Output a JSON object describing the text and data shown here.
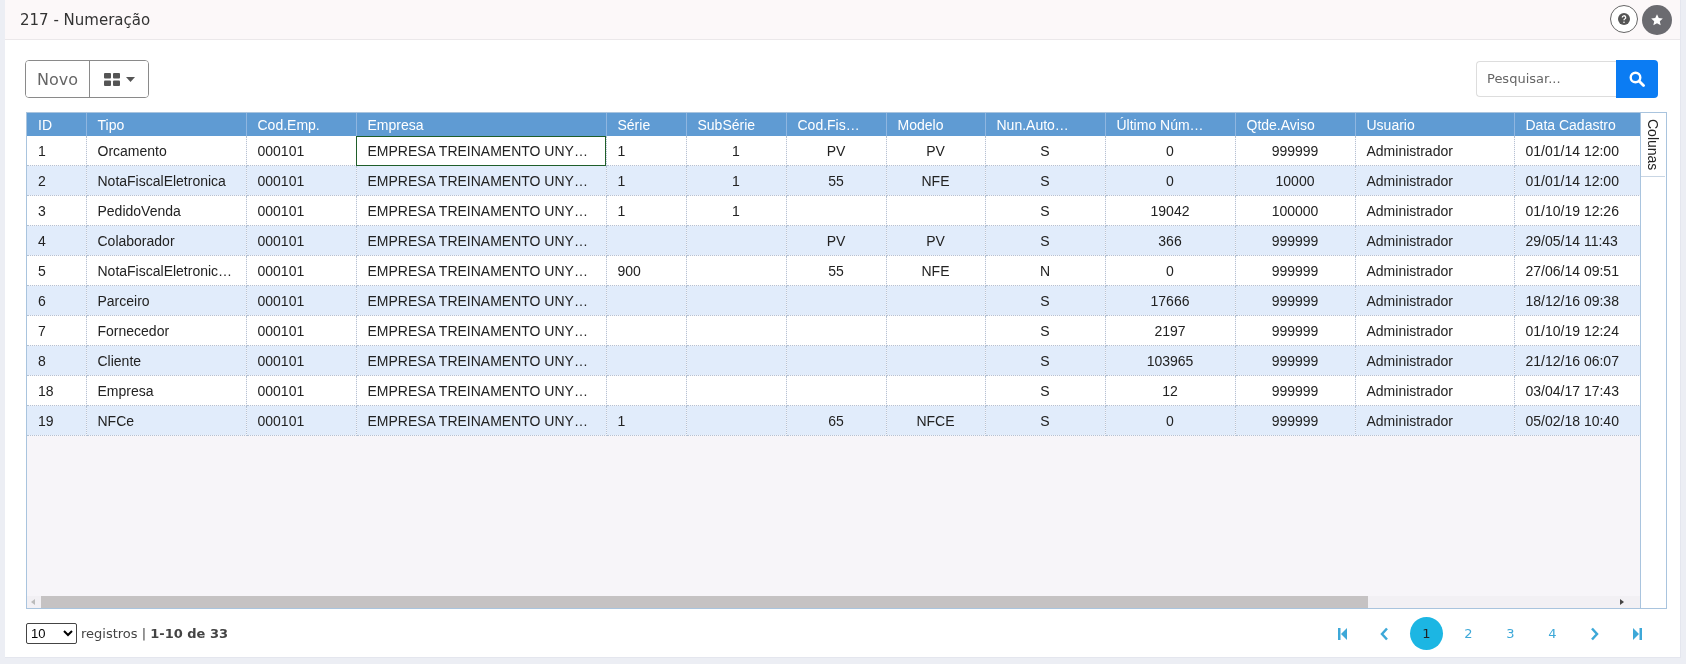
{
  "page": {
    "title": "217 - Numeração"
  },
  "toolbar": {
    "new_button": "Novo",
    "search": {
      "placeholder": "Pesquisar..."
    }
  },
  "table": {
    "columns": [
      "ID",
      "Tipo",
      "Cod.Emp.",
      "Empresa",
      "Série",
      "SubSérie",
      "Cod.Fis…",
      "Modelo",
      "Nun.Auto…",
      "Último Núm…",
      "Qtde.Aviso",
      "Usuario",
      "Data Cadastro"
    ],
    "rows": [
      [
        "1",
        "Orcamento",
        "000101",
        {
          "text": "EMPRESA TREINAMENTO UNY…",
          "focused": true
        },
        "1",
        "1",
        "PV",
        "PV",
        "S",
        "0",
        "999999",
        "Administrador",
        "01/01/14 12:00"
      ],
      [
        "2",
        "NotaFiscalEletronica",
        "000101",
        "EMPRESA TREINAMENTO UNY…",
        "1",
        "1",
        "55",
        "NFE",
        "S",
        "0",
        "10000",
        "Administrador",
        "01/01/14 12:00"
      ],
      [
        "3",
        "PedidoVenda",
        "000101",
        "EMPRESA TREINAMENTO UNY…",
        "1",
        "1",
        "",
        "",
        "S",
        "19042",
        "100000",
        "Administrador",
        "01/10/19 12:26"
      ],
      [
        "4",
        "Colaborador",
        "000101",
        "EMPRESA TREINAMENTO UNY…",
        "",
        "",
        "PV",
        "PV",
        "S",
        "366",
        "999999",
        "Administrador",
        "29/05/14 11:43"
      ],
      [
        "5",
        "NotaFiscalEletronic…",
        "000101",
        "EMPRESA TREINAMENTO UNY…",
        "900",
        "",
        "55",
        "NFE",
        "N",
        "0",
        "999999",
        "Administrador",
        "27/06/14 09:51"
      ],
      [
        "6",
        "Parceiro",
        "000101",
        "EMPRESA TREINAMENTO UNY…",
        "",
        "",
        "",
        "",
        "S",
        "17666",
        "999999",
        "Administrador",
        "18/12/16 09:38"
      ],
      [
        "7",
        "Fornecedor",
        "000101",
        "EMPRESA TREINAMENTO UNY…",
        "",
        "",
        "",
        "",
        "S",
        "2197",
        "999999",
        "Administrador",
        "01/10/19 12:24"
      ],
      [
        "8",
        "Cliente",
        "000101",
        "EMPRESA TREINAMENTO UNY…",
        "",
        "",
        "",
        "",
        "S",
        "103965",
        "999999",
        "Administrador",
        "21/12/16 06:07"
      ],
      [
        "18",
        "Empresa",
        "000101",
        "EMPRESA TREINAMENTO UNY…",
        "",
        "",
        "",
        "",
        "S",
        "12",
        "999999",
        "Administrador",
        "03/04/17 17:43"
      ],
      [
        "19",
        "NFCe",
        "000101",
        "EMPRESA TREINAMENTO UNY…",
        "1",
        "",
        "65",
        "NFCE",
        "S",
        "0",
        "999999",
        "Administrador",
        "05/02/18 10:40"
      ]
    ],
    "columns_tab": "Colunas"
  },
  "footer": {
    "page_size": "10",
    "summary": "registros | **1-10 de 33**",
    "pages": [
      {
        "label": "1",
        "selected": true
      },
      {
        "label": "2",
        "selected": false
      },
      {
        "label": "3",
        "selected": false
      },
      {
        "label": "4",
        "selected": false
      }
    ]
  }
}
